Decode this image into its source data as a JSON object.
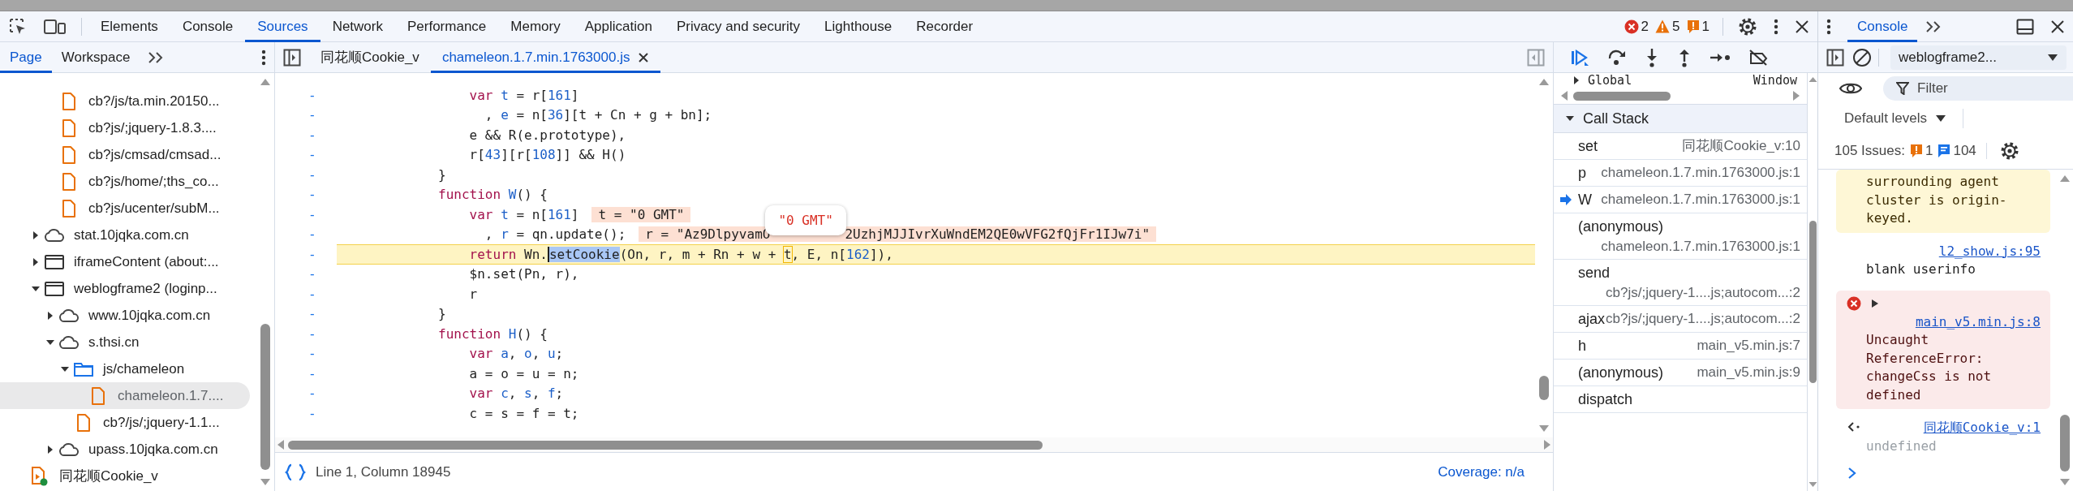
{
  "main_tabs": [
    {
      "label": "Elements",
      "selected": false
    },
    {
      "label": "Console",
      "selected": false
    },
    {
      "label": "Sources",
      "selected": true
    },
    {
      "label": "Network",
      "selected": false
    },
    {
      "label": "Performance",
      "selected": false
    },
    {
      "label": "Memory",
      "selected": false
    },
    {
      "label": "Application",
      "selected": false
    },
    {
      "label": "Privacy and security",
      "selected": false
    },
    {
      "label": "Lighthouse",
      "selected": false
    },
    {
      "label": "Recorder",
      "selected": false
    }
  ],
  "counters": [
    {
      "kind": "error",
      "count": "2"
    },
    {
      "kind": "warning",
      "count": "5"
    },
    {
      "kind": "issue",
      "count": "1"
    }
  ],
  "sources": {
    "navigator_tabs": [
      {
        "label": "Page",
        "selected": true
      },
      {
        "label": "Workspace",
        "selected": false
      }
    ],
    "tree": [
      {
        "children": [
          {
            "children": [
              {
                "label": "cb?/js/ta.min.20150...",
                "kind": "file",
                "selected": false
              },
              {
                "label": "cb?js/;jquery-1.8.3....",
                "kind": "file",
                "selected": false
              },
              {
                "label": "cb?js/cmsad/cmsad...",
                "kind": "file",
                "selected": false
              },
              {
                "label": "cb?js/home/;ths_co...",
                "kind": "file",
                "selected": false
              },
              {
                "label": "cb?js/ucenter/subM...",
                "kind": "file",
                "selected": false
              }
            ]
          },
          {
            "label": "stat.10jqka.com.cn",
            "kind": "cloud",
            "expanded": false,
            "selected": false
          },
          {
            "label": "iframeContent (about:...",
            "kind": "frame",
            "expanded": false,
            "selected": false
          },
          {
            "label": "weblogframe2 (loginp...",
            "kind": "frame",
            "expanded": true,
            "selected": false,
            "children": [
              {
                "label": "www.10jqka.com.cn",
                "kind": "cloud",
                "expanded": false,
                "selected": false
              },
              {
                "label": "s.thsi.cn",
                "kind": "cloud",
                "expanded": true,
                "selected": false,
                "children": [
                  {
                    "label": "js/chameleon",
                    "kind": "folder",
                    "expanded": true,
                    "selected": false,
                    "children": [
                      {
                        "label": "chameleon.1.7....",
                        "kind": "file",
                        "selected": true
                      }
                    ]
                  },
                  {
                    "label": "cb?/js/;jquery-1.1...",
                    "kind": "file",
                    "selected": false
                  }
                ]
              },
              {
                "label": "upass.10jqka.com.cn",
                "kind": "cloud",
                "expanded": false,
                "selected": false
              }
            ]
          }
        ]
      },
      {
        "label": "同花顺Cookie_v",
        "kind": "snippet",
        "selected": false
      }
    ],
    "editor_tabs": [
      {
        "label": "同花顺Cookie_v",
        "selected": false,
        "closable": false
      },
      {
        "label": "chameleon.1.7.min.1763000.js",
        "selected": true,
        "closable": true
      }
    ],
    "code_lines": [
      {
        "gutter": "-",
        "execution": false,
        "tokens": [
          {
            "kind": "kw",
            "text": "            var "
          },
          {
            "kind": "def",
            "text": "t"
          },
          {
            "kind": "plain",
            "text": " = r["
          },
          {
            "kind": "num",
            "text": "161"
          },
          {
            "kind": "plain",
            "text": "]"
          }
        ]
      },
      {
        "gutter": "-",
        "execution": false,
        "tokens": [
          {
            "kind": "plain",
            "text": "              , "
          },
          {
            "kind": "def",
            "text": "e"
          },
          {
            "kind": "plain",
            "text": " = n["
          },
          {
            "kind": "num",
            "text": "36"
          },
          {
            "kind": "plain",
            "text": "][t + Cn + g + bn];"
          }
        ]
      },
      {
        "gutter": "-",
        "execution": false,
        "tokens": [
          {
            "kind": "plain",
            "text": "            e && R(e.prototype),"
          }
        ]
      },
      {
        "gutter": "-",
        "execution": false,
        "tokens": [
          {
            "kind": "plain",
            "text": "            r["
          },
          {
            "kind": "num",
            "text": "43"
          },
          {
            "kind": "plain",
            "text": "][r["
          },
          {
            "kind": "num",
            "text": "108"
          },
          {
            "kind": "plain",
            "text": "]] && H()"
          }
        ]
      },
      {
        "gutter": "-",
        "execution": false,
        "tokens": [
          {
            "kind": "plain",
            "text": "        }"
          }
        ]
      },
      {
        "gutter": "-",
        "execution": false,
        "tokens": [
          {
            "kind": "kw",
            "text": "        function "
          },
          {
            "kind": "def",
            "text": "W"
          },
          {
            "kind": "plain",
            "text": "() {"
          }
        ]
      },
      {
        "gutter": "-",
        "execution": false,
        "tokens": [
          {
            "kind": "kw",
            "text": "            var "
          },
          {
            "kind": "def",
            "text": "t"
          },
          {
            "kind": "plain",
            "text": " = n["
          },
          {
            "kind": "num",
            "text": "161"
          },
          {
            "kind": "plain",
            "text": "]"
          }
        ],
        "inline_value": {
          "parts": [
            "t = \"0 GMT\""
          ]
        }
      },
      {
        "gutter": "-",
        "execution": false,
        "tokens": [
          {
            "kind": "plain",
            "text": "              , "
          },
          {
            "kind": "def",
            "text": "r"
          },
          {
            "kind": "plain",
            "text": " = qn.update();"
          }
        ],
        "inline_value": {
          "parts": [
            "r = \"Az9DlpyvamO",
            "2UzhjMJJIvrXuWndEM2QE0wVFG2fQjFr1IJw7i\""
          ],
          "tooltip": "\"0 GMT\""
        }
      },
      {
        "gutter": "-",
        "execution": true,
        "tokens": [
          {
            "kind": "kw",
            "text": "            return"
          },
          {
            "kind": "plain",
            "text": " Wn."
          },
          {
            "kind": "sel",
            "text": "setCookie"
          },
          {
            "kind": "plain",
            "text": "(On, r, m + Rn + w + "
          },
          {
            "kind": "box",
            "text": "t"
          },
          {
            "kind": "plain",
            "text": ", E, n["
          },
          {
            "kind": "num",
            "text": "162"
          },
          {
            "kind": "plain",
            "text": "]),"
          }
        ]
      },
      {
        "gutter": "-",
        "execution": false,
        "tokens": [
          {
            "kind": "plain",
            "text": "            $n.set(Pn, r),"
          }
        ]
      },
      {
        "gutter": "-",
        "execution": false,
        "tokens": [
          {
            "kind": "plain",
            "text": "            r"
          }
        ]
      },
      {
        "gutter": "-",
        "execution": false,
        "tokens": [
          {
            "kind": "plain",
            "text": "        }"
          }
        ]
      },
      {
        "gutter": "-",
        "execution": false,
        "tokens": [
          {
            "kind": "kw",
            "text": "        function "
          },
          {
            "kind": "def",
            "text": "H"
          },
          {
            "kind": "plain",
            "text": "() {"
          }
        ]
      },
      {
        "gutter": "-",
        "execution": false,
        "tokens": [
          {
            "kind": "kw",
            "text": "            var "
          },
          {
            "kind": "def",
            "text": "a"
          },
          {
            "kind": "plain",
            "text": ", "
          },
          {
            "kind": "def",
            "text": "o"
          },
          {
            "kind": "plain",
            "text": ", "
          },
          {
            "kind": "def",
            "text": "u"
          },
          {
            "kind": "plain",
            "text": ";"
          }
        ]
      },
      {
        "gutter": "-",
        "execution": false,
        "tokens": [
          {
            "kind": "plain",
            "text": "            a = o = u = n;"
          }
        ]
      },
      {
        "gutter": "-",
        "execution": false,
        "tokens": [
          {
            "kind": "kw",
            "text": "            var "
          },
          {
            "kind": "def",
            "text": "c"
          },
          {
            "kind": "plain",
            "text": ", "
          },
          {
            "kind": "def",
            "text": "s"
          },
          {
            "kind": "plain",
            "text": ", "
          },
          {
            "kind": "def",
            "text": "f"
          },
          {
            "kind": "plain",
            "text": ";"
          }
        ]
      },
      {
        "gutter": "-",
        "execution": false,
        "tokens": [
          {
            "kind": "plain",
            "text": "            c = s = f = t;"
          }
        ]
      }
    ],
    "status": {
      "position": "Line 1, Column 18945",
      "coverage": "Coverage: n/a"
    }
  },
  "debugger": {
    "scope_row": {
      "label": "Global",
      "value": "Window",
      "expanded": false
    },
    "call_stack": {
      "title": "Call Stack",
      "expanded": true,
      "frames": [
        {
          "name": "set",
          "location": "同花顺Cookie_v:10",
          "current": false
        },
        {
          "name": "p",
          "location": "chameleon.1.7.min.1763000.js:1",
          "current": false
        },
        {
          "name": "W",
          "location": "chameleon.1.7.min.1763000.js:1",
          "current": true
        },
        {
          "name": "(anonymous)",
          "location": "chameleon.1.7.min.1763000.js:1",
          "current": false
        },
        {
          "name": "send",
          "location": "cb?js/;jquery-1....js;autocom...:2",
          "current": false
        },
        {
          "name": "ajax",
          "location": "cb?js/;jquery-1....js;autocom...:2",
          "current": false
        },
        {
          "name": "h",
          "location": "main_v5.min.js:7",
          "current": false
        },
        {
          "name": "(anonymous)",
          "location": "main_v5.min.js:9",
          "current": false
        },
        {
          "name": "dispatch",
          "current": false
        }
      ]
    }
  },
  "console_drawer": {
    "tabs": [
      {
        "label": "Console",
        "selected": true
      }
    ],
    "context": "weblogframe2...",
    "filter": {
      "placeholder": "Filter"
    },
    "levels": "Default levels",
    "issues": {
      "label": "105 Issues:",
      "warnings": "1",
      "info": "104"
    },
    "messages": [
      {
        "kind": "warning",
        "text": "surrounding agent cluster is origin-keyed."
      },
      {
        "kind": "log",
        "text": "blank userinfo",
        "source": "l2_show.js:95"
      },
      {
        "kind": "error",
        "text": "Uncaught ReferenceError: changeCss is not defined",
        "source": "main_v5.min.js:8",
        "expanded": false
      },
      {
        "kind": "result",
        "text": "undefined",
        "source": "同花顺Cookie_v:1"
      }
    ]
  }
}
